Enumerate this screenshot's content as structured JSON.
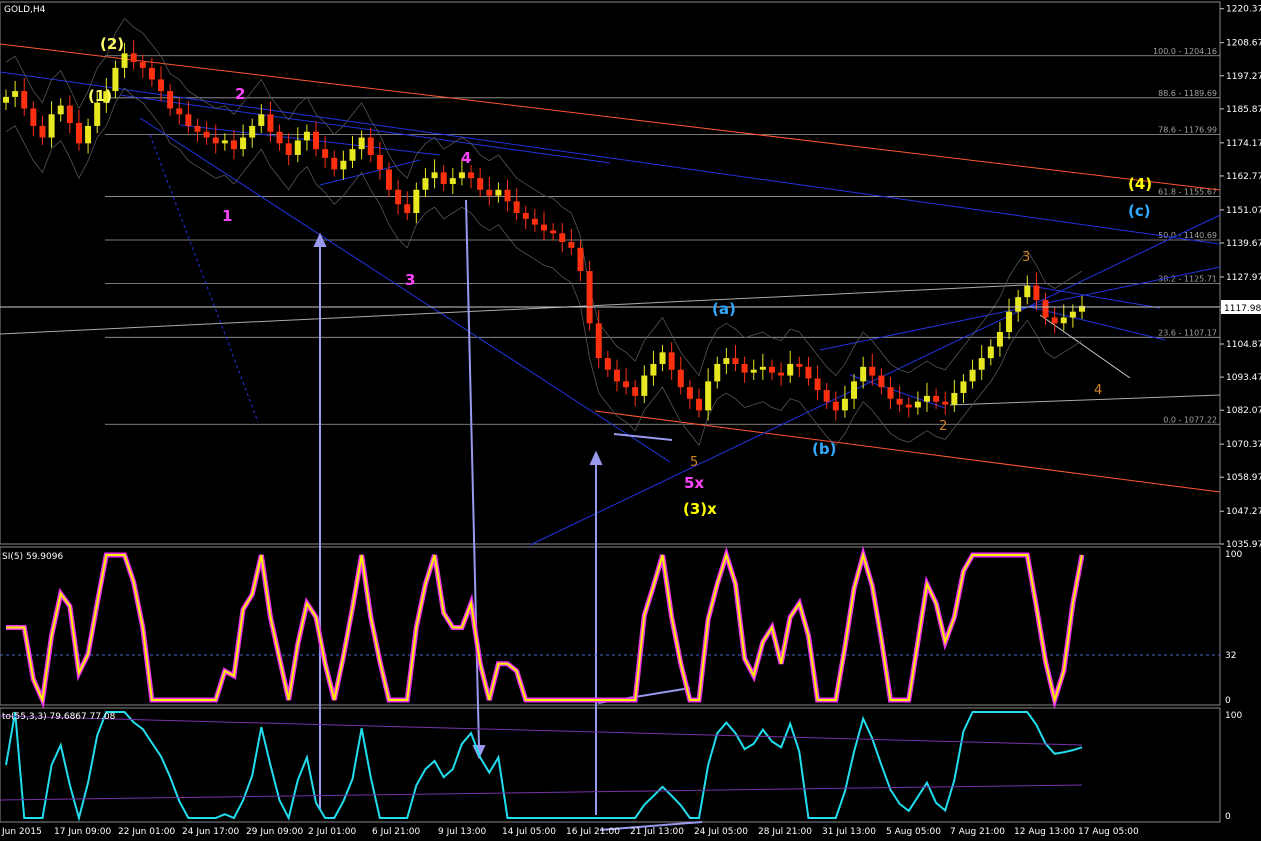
{
  "chart_data": {
    "type": "candlestick",
    "symbol_label": "GOLD,H4",
    "current_price": 1117.98,
    "current_price_label": "1117.98",
    "price_axis": {
      "ylim": [
        1035.97,
        1222.0
      ],
      "ticks": [
        1220.37,
        1208.67,
        1197.27,
        1185.87,
        1174.17,
        1162.77,
        1151.07,
        1139.67,
        1127.97,
        1116.57,
        1104.87,
        1093.47,
        1082.07,
        1070.37,
        1058.97,
        1047.27,
        1035.97
      ]
    },
    "time_axis": {
      "labels": [
        "Jun 2015",
        "17 Jun 09:00",
        "22 Jun 01:00",
        "24 Jun 17:00",
        "29 Jun 09:00",
        "2 Jul 01:00",
        "6 Jul 21:00",
        "9 Jul 13:00",
        "14 Jul 05:00",
        "16 Jul 21:00",
        "21 Jul 13:00",
        "24 Jul 05:00",
        "28 Jul 21:00",
        "31 Jul 13:00",
        "5 Aug 05:00",
        "7 Aug 21:00",
        "12 Aug 13:00",
        "17 Aug 05:00"
      ]
    },
    "fib_levels": [
      {
        "label": "100.0 - 1204.16",
        "value": 1204.16
      },
      {
        "label": "88.6 - 1189.69",
        "value": 1189.69
      },
      {
        "label": "78.6 - 1176.99",
        "value": 1176.99
      },
      {
        "label": "61.8 - 1155.67",
        "value": 1155.67
      },
      {
        "label": "50.0 - 1140.69",
        "value": 1140.69
      },
      {
        "label": "38.2 - 1125.71",
        "value": 1125.71
      },
      {
        "label": "23.6 - 1107.17",
        "value": 1107.17
      },
      {
        "label": "0.0 - 1077.22",
        "value": 1077.22
      }
    ],
    "price_series": [
      1190,
      1192,
      1186,
      1180,
      1176,
      1184,
      1187,
      1181,
      1174,
      1180,
      1188,
      1192,
      1200,
      1205,
      1202,
      1200,
      1196,
      1192,
      1186,
      1184,
      1180,
      1178,
      1176,
      1174,
      1175,
      1172,
      1176,
      1180,
      1184,
      1178,
      1174,
      1170,
      1175,
      1178,
      1172,
      1169,
      1165,
      1168,
      1172,
      1176,
      1170,
      1165,
      1158,
      1153,
      1150,
      1158,
      1162,
      1164,
      1160,
      1162,
      1164,
      1162,
      1158,
      1156,
      1158,
      1154,
      1150,
      1148,
      1146,
      1144,
      1143,
      1140,
      1138,
      1130,
      1112,
      1100,
      1096,
      1092,
      1090,
      1087,
      1094,
      1098,
      1102,
      1096,
      1090,
      1086,
      1082,
      1092,
      1098,
      1100,
      1098,
      1095,
      1096,
      1097,
      1095,
      1094,
      1098,
      1097,
      1093,
      1089,
      1085,
      1082,
      1086,
      1092,
      1097,
      1094,
      1090,
      1086,
      1084,
      1083,
      1085,
      1087,
      1085,
      1084,
      1088,
      1092,
      1096,
      1100,
      1104,
      1109,
      1116,
      1121,
      1125,
      1120,
      1114,
      1112,
      1114,
      1116,
      1118
    ],
    "wave_labels": [
      {
        "text": "(2)",
        "color": "#ffff66"
      },
      {
        "text": "(1)",
        "color": "#ffff66"
      },
      {
        "text": "2",
        "color": "#ff44ff"
      },
      {
        "text": "1",
        "color": "#ff44ff"
      },
      {
        "text": "3",
        "color": "#ff44ff"
      },
      {
        "text": "4",
        "color": "#ff44ff"
      },
      {
        "text": "5x",
        "color": "#ff44ff"
      },
      {
        "text": "(3)x",
        "color": "#ffff00"
      },
      {
        "text": "(4)",
        "color": "#ffff00"
      },
      {
        "text": "(c)",
        "color": "#33aaff"
      },
      {
        "text": "(a)",
        "color": "#33aaff"
      },
      {
        "text": "(b)",
        "color": "#33aaff"
      },
      {
        "text": "5",
        "color": "#d08020"
      },
      {
        "text": "3",
        "color": "#d08020"
      },
      {
        "text": "2",
        "color": "#d08020"
      },
      {
        "text": "4",
        "color": "#d08020"
      }
    ],
    "indicator1": {
      "label": "SI(5) 59.9096",
      "ylim": [
        0,
        100
      ],
      "ticks": [
        100,
        32,
        0
      ],
      "level_line": 32
    },
    "indicator2": {
      "label": "to(55,3,3) 79.6867 77.08",
      "ylim": [
        0,
        100
      ],
      "ticks": [
        100,
        0
      ]
    },
    "colors": {
      "background": "#000000",
      "bull": "#e8e820",
      "bear": "#ff3010",
      "grid": "#808080",
      "fib": "#a0a0a0",
      "channel": "#2233dd",
      "trend_red": "#ff5533",
      "arrow": "#9999ee",
      "rsi": "#ffee00",
      "rsi_glow": "#ee33ee",
      "stoch": "#22ddee"
    }
  }
}
